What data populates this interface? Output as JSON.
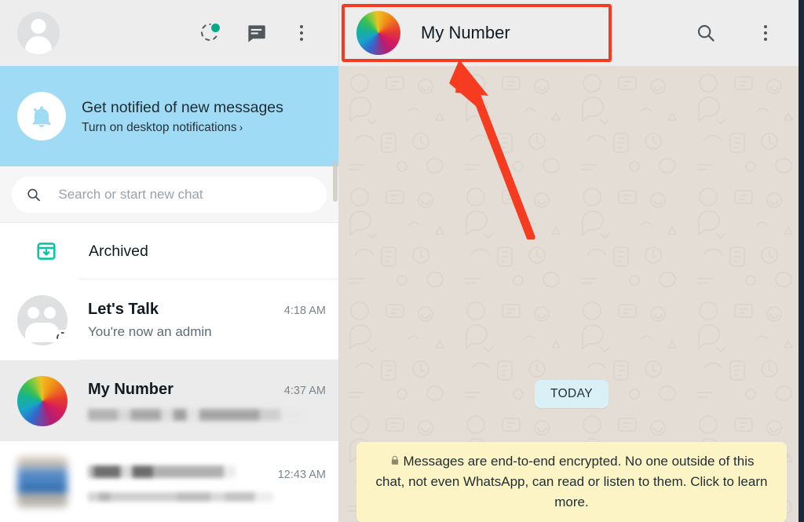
{
  "sidebar": {
    "header": {
      "avatar_icon": "person-avatar-icon",
      "status_icon": "status-ring-icon",
      "new_chat_icon": "new-chat-icon",
      "menu_icon": "overflow-menu-icon"
    },
    "notification_banner": {
      "icon": "bell-off-icon",
      "title": "Get notified of new messages",
      "action": "Turn on desktop notifications",
      "chevron": "›"
    },
    "search": {
      "icon": "search-icon",
      "placeholder": "Search or start new chat",
      "value": ""
    },
    "archived": {
      "icon": "archive-box-icon",
      "label": "Archived"
    },
    "chats": [
      {
        "name": "Let's Talk",
        "time": "4:18 AM",
        "preview": "You're now an admin",
        "avatar": "group-avatar-icon",
        "badge": "disappearing-messages-timer-icon",
        "selected": false,
        "blurred": false
      },
      {
        "name": "My Number",
        "time": "4:37 AM",
        "preview": "",
        "avatar": "color-wheel-avatar",
        "selected": true,
        "blurred": true
      },
      {
        "name": "",
        "time": "12:43 AM",
        "preview": "",
        "avatar": "photo-avatar",
        "selected": false,
        "blurred": true
      }
    ]
  },
  "chat": {
    "header": {
      "contact_name": "My Number",
      "avatar": "color-wheel-avatar",
      "search_icon": "search-icon",
      "menu_icon": "overflow-menu-icon"
    },
    "date_divider": "TODAY",
    "encryption_notice": {
      "icon": "lock-icon",
      "text": "Messages are end-to-end encrypted. No one outside of this chat, not even WhatsApp, can read or listen to them. Click to learn more."
    }
  },
  "annotation": {
    "highlight_color": "#f53b20",
    "shape": "rectangle-and-arrow",
    "target": "My Number"
  },
  "colors": {
    "header_bg": "#ededed",
    "banner_bg": "#9fdbf4",
    "chat_bg": "#e4ddd6",
    "accent_teal": "#00bfa5",
    "encryption_bg": "#fdf4c5",
    "date_badge_bg": "#daf0f7"
  }
}
